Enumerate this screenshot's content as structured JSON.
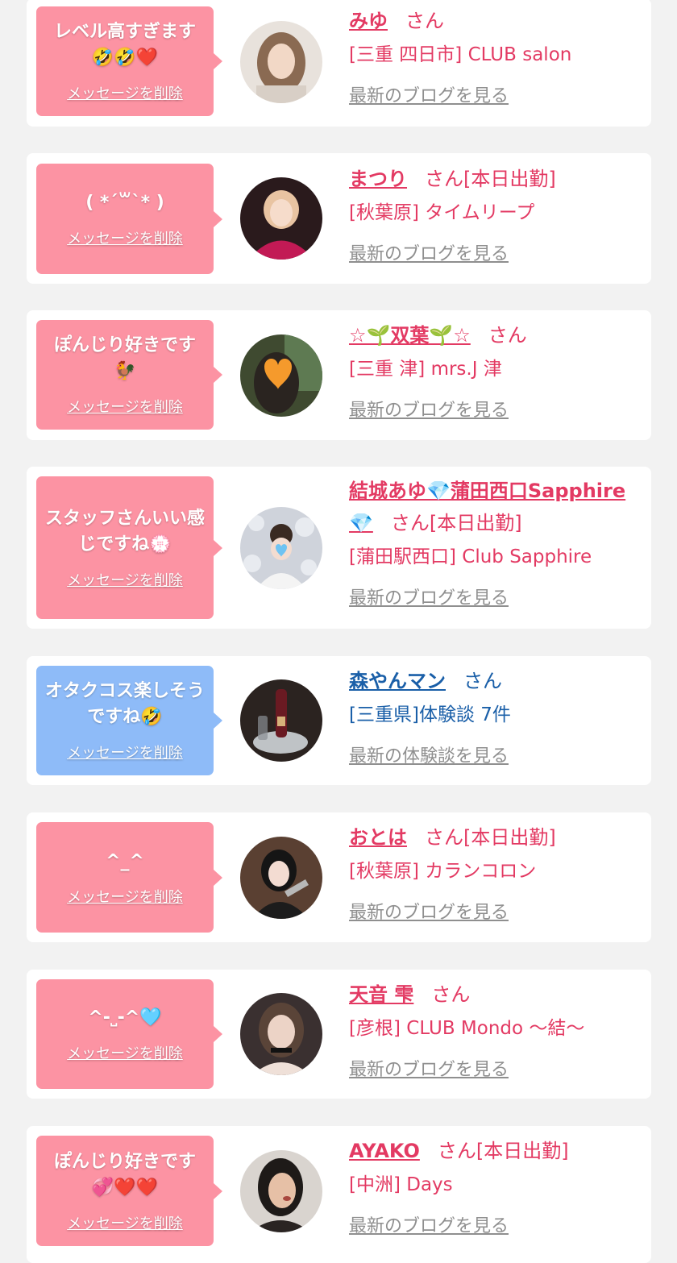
{
  "colors": {
    "pink_bubble": "#fc93a3",
    "blue_bubble": "#8ebbf8",
    "name_pink": "#e33a63",
    "name_blue": "#1a5fa8",
    "link_gray": "#8f8f8f"
  },
  "delete_label": "メッセージを削除",
  "cards": [
    {
      "bubble_color": "pink",
      "message": "レベル高すぎます🤣🤣❤️",
      "name": "みゆ",
      "suffix": "さん",
      "shop": "[三重 四日市] CLUB salon",
      "link": "最新のブログを見る"
    },
    {
      "bubble_color": "pink",
      "message": "( *´꒳`* )",
      "name": "まつり",
      "suffix": "さん[本日出勤]",
      "shop": "[秋葉原] タイムリープ",
      "link": "最新のブログを見る"
    },
    {
      "bubble_color": "pink",
      "message": "ぽんじり好きです🐓",
      "name": "☆🌱双葉🌱☆",
      "suffix": "さん",
      "shop": "[三重 津] mrs.J 津",
      "link": "最新のブログを見る"
    },
    {
      "bubble_color": "pink",
      "message": "スタッフさんいい感じですね💮",
      "name": "結城あゆ💎蒲田西口Sapphire💎",
      "suffix": "さん[本日出勤]",
      "shop": "[蒲田駅西口] Club Sapphire",
      "link": "最新のブログを見る"
    },
    {
      "bubble_color": "blue",
      "message": "オタクコス楽しそうですね🤣",
      "name": "森やんマン",
      "suffix": "さん",
      "shop": "[三重県]体験談 7件",
      "link": "最新の体験談を見る"
    },
    {
      "bubble_color": "pink",
      "message": "^_^",
      "name": "おとは",
      "suffix": "さん[本日出勤]",
      "shop": "[秋葉原] カランコロン",
      "link": "最新のブログを見る"
    },
    {
      "bubble_color": "pink",
      "message": "^-˽-^🩵",
      "name": "天音 雫",
      "suffix": "さん",
      "shop": "[彦根] CLUB Mondo ～結～",
      "link": "最新のブログを見る"
    },
    {
      "bubble_color": "pink",
      "message": "ぽんじり好きです💞❤️❤️",
      "name": "AYAKO",
      "suffix": "さん[本日出勤]",
      "shop": "[中洲] Days",
      "link": "最新のブログを見る"
    }
  ]
}
